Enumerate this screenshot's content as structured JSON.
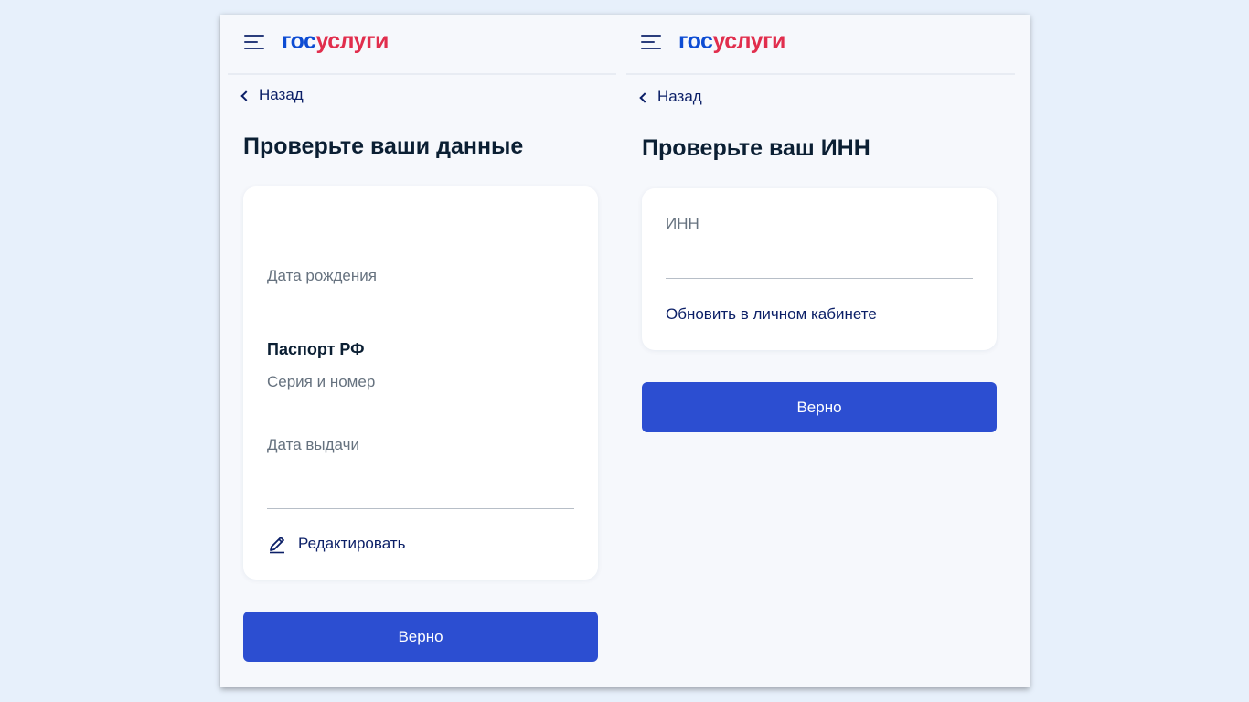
{
  "brand": {
    "logo_part1": "гос",
    "logo_part2": "услуги"
  },
  "colors": {
    "brand_blue": "#0d4cd3",
    "brand_red": "#e12e4d",
    "button": "#2c4ed1",
    "text_dark": "#0b1f33",
    "link": "#0b1f67"
  },
  "icons": {
    "menu": "hamburger-icon",
    "back": "chevron-left-icon",
    "edit": "pencil-icon"
  },
  "screens": {
    "personal": {
      "back_label": "Назад",
      "title": "Проверьте ваши данные",
      "fields": {
        "birth_date_label": "Дата рождения",
        "passport_title": "Паспорт РФ",
        "series_number_label": "Серия и номер",
        "issue_date_label": "Дата выдачи"
      },
      "edit_link": "Редактировать",
      "confirm_button": "Верно"
    },
    "inn": {
      "back_label": "Назад",
      "title": "Проверьте ваш ИНН",
      "inn_label": "ИНН",
      "update_link": "Обновить в личном кабинете",
      "confirm_button": "Верно"
    }
  }
}
